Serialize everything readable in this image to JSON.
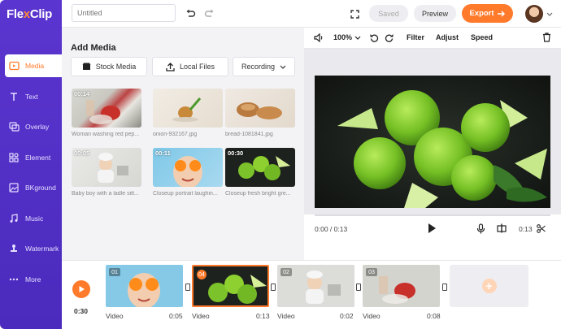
{
  "app": {
    "logo": "FlexClip"
  },
  "sidebar": {
    "items": [
      {
        "label": "Media",
        "icon": "media-icon"
      },
      {
        "label": "Text",
        "icon": "text-icon"
      },
      {
        "label": "Overlay",
        "icon": "overlay-icon"
      },
      {
        "label": "Element",
        "icon": "element-icon"
      },
      {
        "label": "BKground",
        "icon": "background-icon"
      },
      {
        "label": "Music",
        "icon": "music-icon"
      },
      {
        "label": "Watermark",
        "icon": "watermark-icon"
      },
      {
        "label": "More",
        "icon": "more-icon"
      }
    ],
    "active": "Media"
  },
  "topbar": {
    "title_placeholder": "Untitled",
    "saved_label": "Saved",
    "preview_label": "Preview",
    "export_label": "Export"
  },
  "media": {
    "title": "Add Media",
    "stock_label": "Stock Media",
    "local_label": "Local Files",
    "recording_label": "Recording",
    "items": [
      {
        "duration": "00:14",
        "caption": "Woman washing red pep..."
      },
      {
        "duration": "",
        "caption": "onion-932167.jpg"
      },
      {
        "duration": "",
        "caption": "bread-1081841.jpg"
      },
      {
        "duration": "00:05",
        "caption": "Baby boy with a ladle sitt..."
      },
      {
        "duration": "00:11",
        "caption": "Closeup portrait laughin..."
      },
      {
        "duration": "00:30",
        "caption": "Closeup fresh bright gre..."
      }
    ]
  },
  "preview": {
    "zoom": "100%",
    "filter_label": "Filter",
    "adjust_label": "Adjust",
    "speed_label": "Speed",
    "time": "0:00 / 0:13",
    "clip_duration": "0:13"
  },
  "timeline": {
    "total": "0:30",
    "clips": [
      {
        "num": "01",
        "label": "Video",
        "time": "0:05"
      },
      {
        "num": "04",
        "label": "Video",
        "time": "0:13"
      },
      {
        "num": "02",
        "label": "Video",
        "time": "0:02"
      },
      {
        "num": "03",
        "label": "Video",
        "time": "0:08"
      }
    ]
  },
  "colors": {
    "brand": "#5b35cf",
    "accent": "#ff7a2a"
  }
}
